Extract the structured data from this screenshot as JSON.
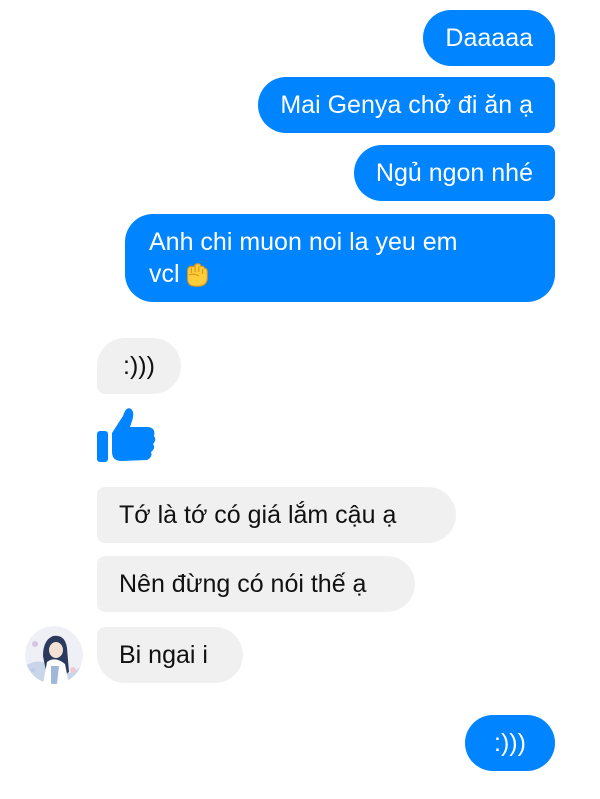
{
  "conversation": {
    "messages": [
      {
        "side": "out",
        "text": "Daaaaa"
      },
      {
        "side": "out",
        "text": "Mai Genya chở đi ăn ạ"
      },
      {
        "side": "out",
        "text": "Ngủ ngon nhé"
      },
      {
        "side": "out",
        "text_line1": "Anh chi muon noi la yeu em",
        "text_line2": "vcl",
        "emoji": "raised-fist-emoji"
      },
      {
        "side": "in",
        "text": ":)))"
      },
      {
        "side": "in",
        "type": "like",
        "icon": "thumbs-up-icon"
      },
      {
        "side": "in",
        "text": "Tớ là tớ có giá lắm cậu ạ"
      },
      {
        "side": "in",
        "text": "Nên đừng có nói thế ạ"
      },
      {
        "side": "in",
        "text": "Bi ngai i"
      },
      {
        "side": "out",
        "text": ":)))"
      }
    ]
  },
  "contact": {
    "avatar_icon": "contact-avatar"
  },
  "colors": {
    "outgoing_bubble": "#0084ff",
    "incoming_bubble": "#f0f0f0",
    "outgoing_text": "#ffffff",
    "incoming_text": "#111111"
  }
}
